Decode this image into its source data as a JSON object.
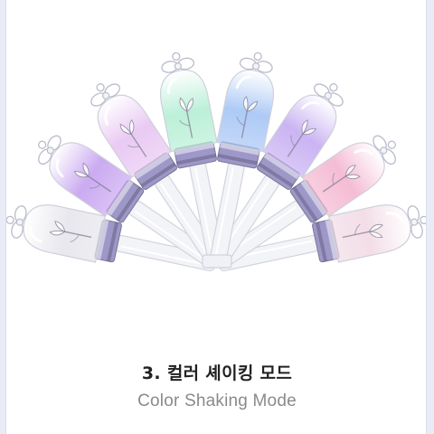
{
  "product": {
    "image": "lightstick-fan-spread-icon",
    "stick_colors": [
      "#e6e6ec",
      "#c8a6f0",
      "#e8c7f2",
      "#b8efd6",
      "#a9c7f5",
      "#c8b0f2",
      "#f4b9d2",
      "#f2dce6"
    ],
    "band_color": "#9e98c8"
  },
  "caption": {
    "title_ko": "3. 컬러 셰이킹 모드",
    "subtitle_en": "Color Shaking Mode"
  },
  "theme": {
    "background": "#e9ecf6",
    "panel": "#ffffff",
    "title_color": "#222222",
    "subtitle_color": "#8a8a8a"
  }
}
